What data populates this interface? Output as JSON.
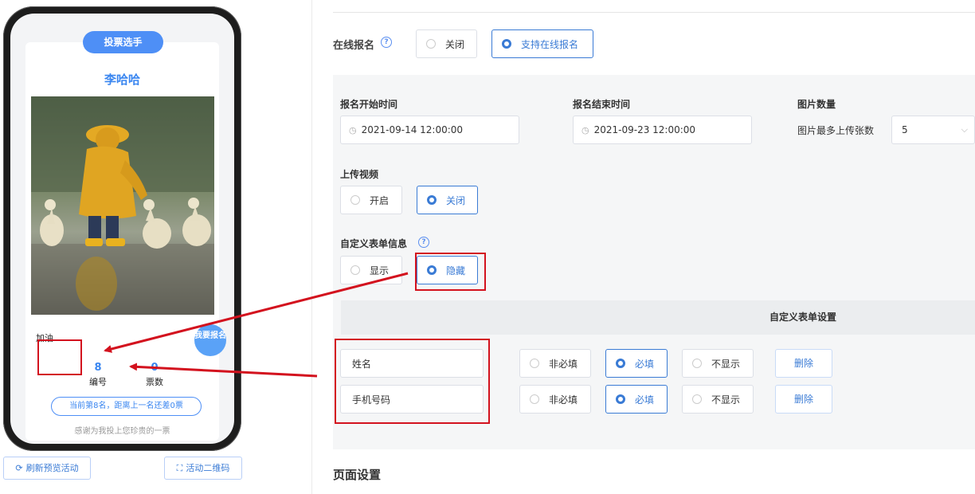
{
  "preview": {
    "vote_button": "投票选手",
    "contestant_name": "李哈哈",
    "cheer_label": "加油",
    "signup_bubble": "我要报名",
    "stats": [
      {
        "value": "8",
        "label": "编号"
      },
      {
        "value": "0",
        "label": "票数"
      }
    ],
    "rank_text": "当前第8名，距离上一名还差0票",
    "thanks_text": "感谢为我投上您珍贵的一票",
    "refresh_button": "刷新预览活动",
    "qr_button": "活动二维码"
  },
  "online_signup": {
    "label": "在线报名",
    "options": [
      {
        "label": "关闭",
        "selected": false
      },
      {
        "label": "支持在线报名",
        "selected": true
      }
    ]
  },
  "signup_period": {
    "start_label": "报名开始时间",
    "start_value": "2021-09-14 12:00:00",
    "end_label": "报名结束时间",
    "end_value": "2021-09-23 12:00:00"
  },
  "image_count": {
    "label": "图片数量",
    "max_label": "图片最多上传张数",
    "value": "5"
  },
  "upload_video": {
    "label": "上传视频",
    "options": [
      {
        "label": "开启",
        "selected": false
      },
      {
        "label": "关闭",
        "selected": true
      }
    ]
  },
  "custom_form_info": {
    "label": "自定义表单信息",
    "options": [
      {
        "label": "显示",
        "selected": false
      },
      {
        "label": "隐藏",
        "selected": true
      }
    ]
  },
  "custom_form_settings": {
    "header": "自定义表单设置",
    "rows": [
      {
        "field": "姓名",
        "options": [
          "非必填",
          "必填",
          "不显示"
        ],
        "selected": 1,
        "delete": "删除"
      },
      {
        "field": "手机号码",
        "options": [
          "非必填",
          "必填",
          "不显示"
        ],
        "selected": 1,
        "delete": "删除"
      }
    ]
  },
  "page_settings": {
    "title": "页面设置"
  },
  "colors": {
    "accent": "#3a7bd5",
    "annotation": "#d3121e",
    "panel": "#f5f6f7"
  }
}
